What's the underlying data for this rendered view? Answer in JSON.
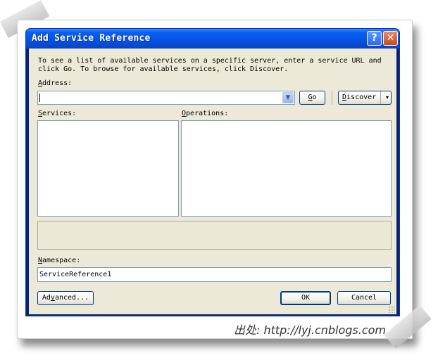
{
  "window": {
    "title": "Add Service Reference",
    "help_glyph": "?",
    "close_glyph": "✕"
  },
  "intro_text": "To see a list of available services on a specific server, enter a service URL and click Go. To browse for available services, click Discover.",
  "address": {
    "label_first": "A",
    "label_rest": "ddress:",
    "value": ""
  },
  "buttons": {
    "go_first": "G",
    "go_rest": "o",
    "discover_first": "D",
    "discover_rest": "iscover",
    "discover_arrow": "▾",
    "advanced_pre": "Ad",
    "advanced_ul": "v",
    "advanced_post": "anced...",
    "ok": "OK",
    "cancel": "Cancel"
  },
  "services": {
    "label_first": "S",
    "label_rest": "ervices:"
  },
  "operations": {
    "label_first": "O",
    "label_rest": "perations:"
  },
  "namespace": {
    "label_first": "N",
    "label_rest": "amespace:",
    "value": "ServiceReference1"
  },
  "icons": {
    "combo_arrow": "chevron-down-icon",
    "help": "help-icon",
    "close": "close-icon"
  },
  "colors": {
    "titlebar": "#0752e3",
    "client": "#ece9d8",
    "close": "#c84a22"
  },
  "watermark": "出处: http://lyj.cnblogs.com"
}
